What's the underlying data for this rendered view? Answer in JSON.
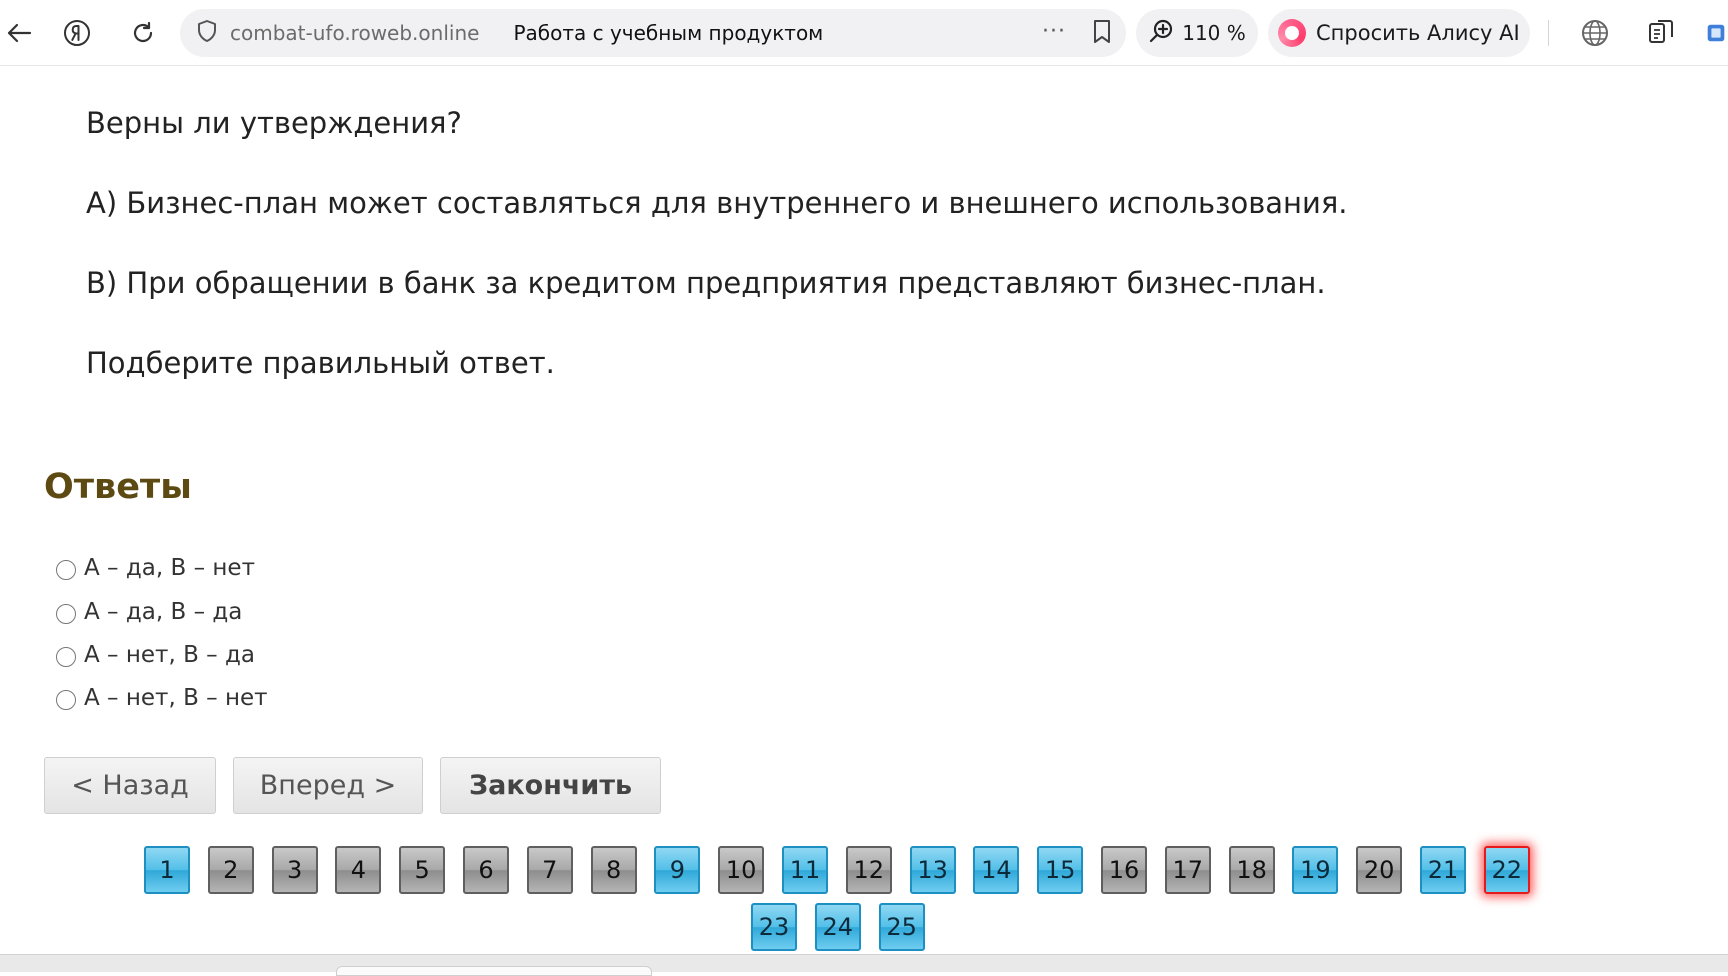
{
  "browser": {
    "domain": "combat-ufo.roweb.online",
    "page_title": "Работа с учебным продуктом",
    "zoom": "110 %",
    "alice_label": "Спросить Алису AI",
    "more": "···"
  },
  "question": {
    "lines": [
      "Верны ли утверждения?",
      "А) Бизнес-план может составляться для внутреннего и внешнего использования.",
      "В) При обращении в банк за кредитом предприятия представляют бизнес-план.",
      "Подберите правильный ответ."
    ]
  },
  "answers": {
    "title": "Ответы",
    "options": [
      "А – да, В – нет",
      "А – да, В – да",
      "А – нет, В – да",
      "А – нет, В – нет"
    ]
  },
  "nav": {
    "back": "< Назад",
    "forward": "Вперед >",
    "finish": "Закончить"
  },
  "pager": {
    "current": 22,
    "items": [
      {
        "n": "1",
        "state": "answered"
      },
      {
        "n": "2",
        "state": "unanswered"
      },
      {
        "n": "3",
        "state": "unanswered"
      },
      {
        "n": "4",
        "state": "unanswered"
      },
      {
        "n": "5",
        "state": "unanswered"
      },
      {
        "n": "6",
        "state": "unanswered"
      },
      {
        "n": "7",
        "state": "unanswered"
      },
      {
        "n": "8",
        "state": "unanswered"
      },
      {
        "n": "9",
        "state": "answered"
      },
      {
        "n": "10",
        "state": "unanswered"
      },
      {
        "n": "11",
        "state": "answered"
      },
      {
        "n": "12",
        "state": "unanswered"
      },
      {
        "n": "13",
        "state": "answered"
      },
      {
        "n": "14",
        "state": "answered"
      },
      {
        "n": "15",
        "state": "answered"
      },
      {
        "n": "16",
        "state": "unanswered"
      },
      {
        "n": "17",
        "state": "unanswered"
      },
      {
        "n": "18",
        "state": "unanswered"
      },
      {
        "n": "19",
        "state": "answered"
      },
      {
        "n": "20",
        "state": "unanswered"
      },
      {
        "n": "21",
        "state": "answered"
      },
      {
        "n": "22",
        "state": "answered"
      },
      {
        "n": "23",
        "state": "answered"
      },
      {
        "n": "24",
        "state": "answered"
      },
      {
        "n": "25",
        "state": "answered"
      }
    ]
  },
  "colors": {
    "answers_title": "#5c4a12",
    "answered": "#52bfe8",
    "unanswered": "#a8a8a8",
    "current_border": "#e61a1a"
  }
}
